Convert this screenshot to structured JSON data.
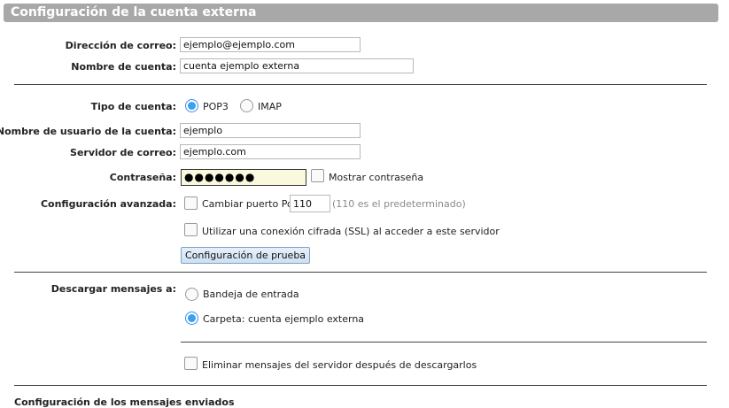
{
  "header": {
    "title": "Configuración de la cuenta externa"
  },
  "identity": {
    "email_label": "Dirección de correo:",
    "email_value": "ejemplo@ejemplo.com",
    "account_name_label": "Nombre de cuenta:",
    "account_name_value": "cuenta ejemplo externa"
  },
  "server": {
    "account_type_label": "Tipo de cuenta:",
    "account_type_options": [
      {
        "label": "POP3",
        "selected": true
      },
      {
        "label": "IMAP",
        "selected": false
      }
    ],
    "username_label": "Nombre de usuario de la cuenta:",
    "username_value": "ejemplo",
    "mail_server_label": "Servidor de correo:",
    "mail_server_value": "ejemplo.com",
    "password_label": "Contraseña:",
    "password_mask": "●●●●●●●",
    "show_password_label": "Mostrar contraseña",
    "advanced_label": "Configuración avanzada:",
    "change_port_label": "Cambiar puerto Pop",
    "port_value": "110",
    "port_hint": "(110 es el predeterminado)",
    "ssl_label": "Utilizar una conexión cifrada (SSL) al acceder a este servidor",
    "test_button": "Configuración de prueba"
  },
  "download": {
    "label": "Descargar mensajes a:",
    "options": [
      {
        "label": "Bandeja de entrada",
        "selected": false
      },
      {
        "label": "Carpeta: cuenta ejemplo externa",
        "selected": true
      }
    ],
    "delete_label": "Eliminar mensajes del servidor después de descargarlos"
  },
  "sent": {
    "section_label": "Configuración de los mensajes enviados"
  },
  "colors": {
    "accent": "#3aa0f0",
    "title_bar": "#a8a8a8",
    "password_bg": "#fbf9dd"
  }
}
